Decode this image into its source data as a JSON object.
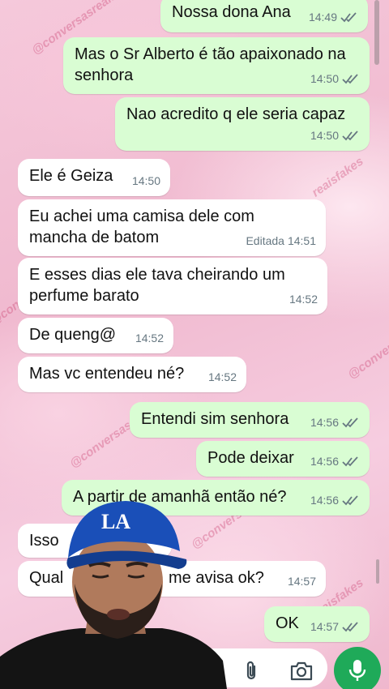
{
  "messages": [
    {
      "dir": "out",
      "text": "Nossa dona Ana",
      "time": "14:49",
      "read": true
    },
    {
      "dir": "out",
      "text": "Mas o Sr Alberto é tão apaixonado na senhora",
      "time": "14:50",
      "read": true
    },
    {
      "dir": "out",
      "text": "Nao acredito q ele seria capaz",
      "time": "14:50",
      "read": true
    },
    {
      "dir": "in",
      "text": "Ele é Geiza",
      "time": "14:50"
    },
    {
      "dir": "in",
      "text": "Eu achei uma camisa dele com mancha de batom",
      "time": "14:51",
      "edited_label": "Editada"
    },
    {
      "dir": "in",
      "text": "E esses dias ele tava cheirando um perfume barato",
      "time": "14:52"
    },
    {
      "dir": "in",
      "text": "De queng@",
      "time": "14:52"
    },
    {
      "dir": "in",
      "text": "Mas vc entendeu né?",
      "time": "14:52"
    },
    {
      "dir": "out",
      "text": "Entendi sim senhora",
      "time": "14:56",
      "read": true
    },
    {
      "dir": "out",
      "text": "Pode deixar",
      "time": "14:56",
      "read": true
    },
    {
      "dir": "out",
      "text": "A partir de amanhã então né?",
      "time": "14:56",
      "read": true
    },
    {
      "dir": "in",
      "text": "Isso",
      "time": ""
    },
    {
      "dir": "in",
      "text_left": "Qual",
      "text_right": "me avisa ok?",
      "time": "14:57"
    },
    {
      "dir": "out",
      "text": "OK",
      "time": "14:57",
      "read": true
    }
  ],
  "watermarks": [
    "@conversasreais",
    "@conversas",
    "reaisfakes",
    "@conversasreais",
    "@conversas",
    "reaisfakes",
    "@conversasre"
  ],
  "colors": {
    "outgoing_bubble": "#d9fdd3",
    "incoming_bubble": "#ffffff",
    "read_ticks": "#667781",
    "mic_button": "#1faa59",
    "wallpaper": "#f3c3d6"
  },
  "icons": {
    "attach": "paperclip-icon",
    "camera": "camera-icon",
    "mic": "microphone-icon"
  },
  "overlay": {
    "cap_logo": "LA"
  }
}
